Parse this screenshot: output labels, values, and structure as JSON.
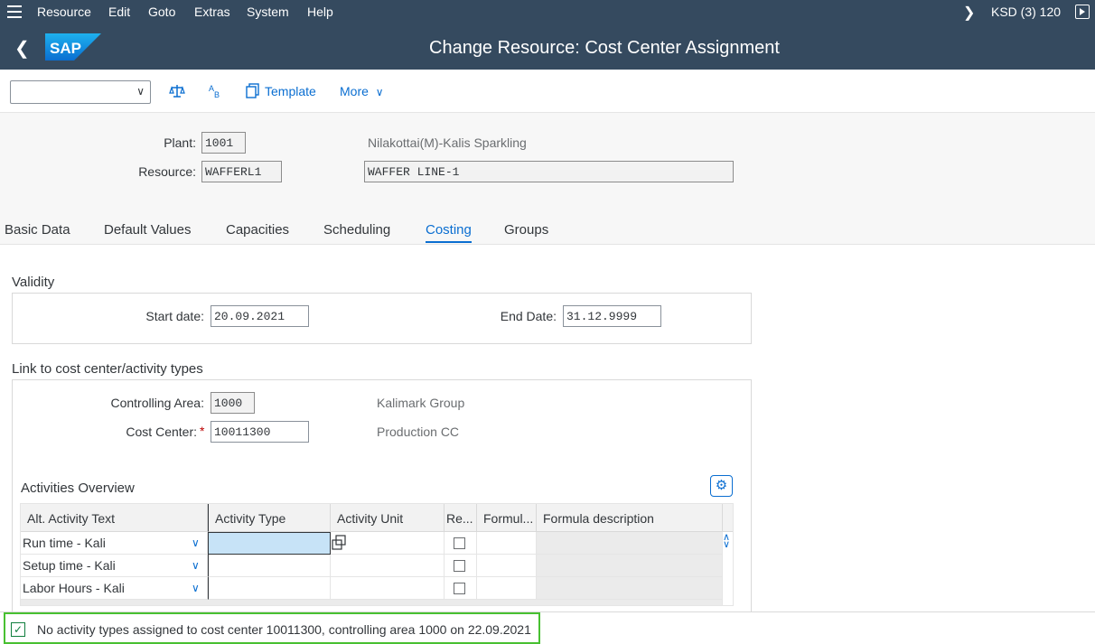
{
  "menubar": {
    "items": [
      "Resource",
      "Edit",
      "Goto",
      "Extras",
      "System",
      "Help"
    ],
    "system_info": "KSD (3) 120"
  },
  "titlebar": {
    "logo_text": "SAP",
    "title": "Change Resource: Cost Center Assignment"
  },
  "toolbar": {
    "select_value": "",
    "template_label": "Template",
    "more_label": "More"
  },
  "header": {
    "plant_label": "Plant:",
    "plant_value": "1001",
    "plant_text": "Nilakottai(M)-Kalis Sparkling",
    "resource_label": "Resource:",
    "resource_value": "WAFFERL1",
    "resource_desc": "WAFFER LINE-1"
  },
  "tabs": [
    "Basic Data",
    "Default Values",
    "Capacities",
    "Scheduling",
    "Costing",
    "Groups"
  ],
  "active_tab": "Costing",
  "validity": {
    "title": "Validity",
    "start_label": "Start date:",
    "start_value": "20.09.2021",
    "end_label": "End Date:",
    "end_value": "31.12.9999"
  },
  "link": {
    "title": "Link to cost center/activity types",
    "ca_label": "Controlling Area:",
    "ca_value": "1000",
    "ca_text": "Kalimark Group",
    "cc_label": "Cost Center:",
    "cc_required": "*",
    "cc_value": "10011300",
    "cc_text": "Production CC"
  },
  "activities": {
    "title": "Activities Overview",
    "columns": [
      "Alt. Activity Text",
      "Activity Type",
      "Activity Unit",
      "Re...",
      "Formul...",
      "Formula description"
    ],
    "rows": [
      {
        "alt_text": "Run time - Kali",
        "activity_type": "",
        "activity_unit": ""
      },
      {
        "alt_text": "Setup time - Kali",
        "activity_type": "",
        "activity_unit": ""
      },
      {
        "alt_text": "Labor Hours - Kali",
        "activity_type": "",
        "activity_unit": ""
      }
    ]
  },
  "status": {
    "message": "No activity types assigned to cost center 10011300, controlling area 1000 on 22.09.2021"
  },
  "colors": {
    "shell": "#354a5f",
    "accent": "#0a6ed1",
    "status_highlight": "#48c031"
  }
}
